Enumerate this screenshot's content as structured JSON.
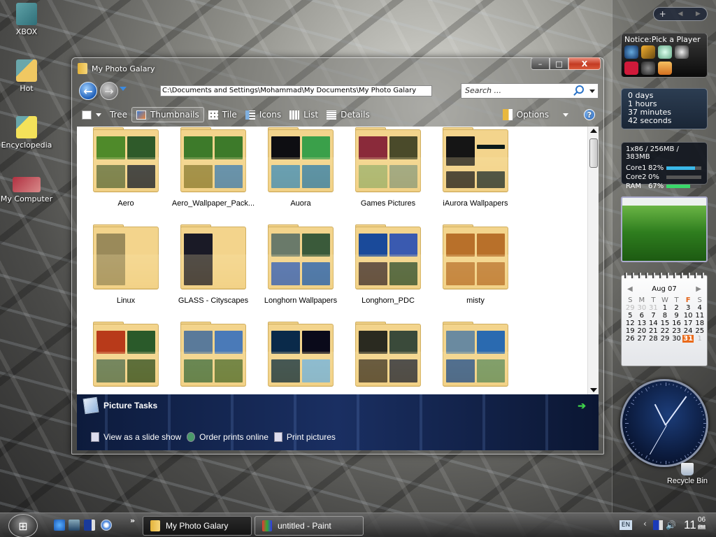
{
  "desktop": {
    "icons": [
      {
        "label": "XBOX"
      },
      {
        "label": "Hot"
      },
      {
        "label": "Encyclopedia"
      },
      {
        "label": "My Computer"
      }
    ],
    "recycle_bin": "Recycle Bin"
  },
  "window": {
    "title": "My Photo Galary",
    "caption": {
      "minimize": "–",
      "maximize": "□",
      "close": "X"
    },
    "address": "C:\\Documents and Settings\\Mohammad\\My Documents\\My Photo Galary",
    "search_placeholder": "Search ...",
    "toolbar": {
      "tree": "Tree",
      "thumbnails": "Thumbnails",
      "tile": "Tile",
      "icons": "Icons",
      "list": "List",
      "details": "Details",
      "options": "Options",
      "help": "?"
    },
    "active_view": "Thumbnails",
    "folders": [
      {
        "name": "Aero",
        "thumbs": [
          "#4f8a2a",
          "#2f5a2a",
          "#5a6a3a",
          "#101828"
        ]
      },
      {
        "name": "Aero_Wallpaper_Pack...",
        "thumbs": [
          "#3d7a2a",
          "#3d7a2a",
          "#8a7a30",
          "#3a7ab0"
        ]
      },
      {
        "name": "Auora",
        "thumbs": [
          "#0e0e12",
          "#3aa04a",
          "#3a8ab8",
          "#2a7aa8"
        ]
      },
      {
        "name": "Games Pictures",
        "thumbs": [
          "#8a2a3a",
          "#4a4a2a",
          "#9ab06a",
          "#8a9a7a"
        ]
      },
      {
        "name": "iAurora Wallpapers",
        "thumbs": [
          "#151515",
          "",
          "#1a1a1a",
          "#1a2a2a"
        ]
      },
      {
        "name": "Linux",
        "thumbs": [
          "#9a8a5a"
        ]
      },
      {
        "name": "GLASS - Cityscapes",
        "thumbs": [
          "#1a1a26"
        ]
      },
      {
        "name": "Longhorn Wallpapers",
        "thumbs": [
          "#6a7a6a",
          "#3a5a3a",
          "#2a5ab8",
          "#1a5ab0"
        ]
      },
      {
        "name": "Longhorn_PDC",
        "thumbs": [
          "#1a4a9a",
          "#3a5ab0",
          "#3a2a2a",
          "#2a4a2a"
        ]
      },
      {
        "name": "misty",
        "thumbs": [
          "#b8702a",
          "#b8702a",
          "#b8702a",
          "#b8702a"
        ]
      },
      {
        "name": "",
        "thumbs": [
          "#b83a1a",
          "#2a5a2a",
          "#4a6a4a",
          "#2a4a1a"
        ]
      },
      {
        "name": "",
        "thumbs": [
          "#5a7a9a",
          "#4a7ab8",
          "#3a6a3a",
          "#4a6a2a"
        ]
      },
      {
        "name": "",
        "thumbs": [
          "#0a2a4a",
          "#0a0a1a",
          "#0a2a3a",
          "#6ab0e0"
        ]
      },
      {
        "name": "",
        "thumbs": [
          "#2a2a20",
          "#3a4a3a",
          "#3a3020",
          "#1a2030"
        ]
      },
      {
        "name": "",
        "thumbs": [
          "#6a8aa0",
          "#2a6ab0",
          "#1a4a8a",
          "#5a8a5a"
        ]
      }
    ],
    "picture_tasks": {
      "title": "Picture Tasks",
      "links": [
        {
          "label": "View as a slide show"
        },
        {
          "label": "Order prints online"
        },
        {
          "label": "Print pictures"
        }
      ],
      "go": "➔"
    }
  },
  "sidebar": {
    "controls": {
      "add": "+",
      "prev": "◀",
      "next": "▶"
    },
    "player": {
      "title": "Notice:Pick a Player",
      "icons": [
        "windows-media-player",
        "winamp",
        "itunes",
        "alien-player",
        "lastfm",
        "player-6",
        "player-7"
      ]
    },
    "uptime": {
      "days": "0 days",
      "hours": "1 hours",
      "minutes": "37 minutes",
      "seconds": "42 seconds"
    },
    "cpu": {
      "summary": "1x86 / 256MB / 383MB",
      "rows": [
        {
          "name": "Core1",
          "percent": "82%",
          "value": 82,
          "color": "#3ab8e8"
        },
        {
          "name": "Core2",
          "percent": "0%",
          "value": 0,
          "color": "#3ab8e8"
        },
        {
          "name": "RAM",
          "percent": "67%",
          "value": 67,
          "color": "#3ad86a"
        }
      ]
    },
    "calendar": {
      "month": "Aug 07",
      "prev": "◀",
      "next": "▶",
      "weekdays": [
        "S",
        "M",
        "T",
        "W",
        "T",
        "F",
        "S"
      ],
      "days": [
        "29",
        "30",
        "31",
        "1",
        "2",
        "3",
        "4",
        "5",
        "6",
        "7",
        "8",
        "9",
        "10",
        "11",
        "12",
        "13",
        "14",
        "15",
        "16",
        "17",
        "18",
        "19",
        "20",
        "21",
        "22",
        "23",
        "24",
        "25",
        "26",
        "27",
        "28",
        "29",
        "30",
        "31",
        "1"
      ],
      "today": "31"
    },
    "clock": {
      "hour": 11,
      "minute": 6
    }
  },
  "taskbar": {
    "start": "⊞",
    "quick_launch": [
      "internet-explorer",
      "show-desktop",
      "switch-windows",
      "media-player"
    ],
    "more": "»",
    "tasks": [
      {
        "label": "My Photo Galary",
        "active": true
      },
      {
        "label": "untitled - Paint",
        "active": false
      }
    ],
    "language": "EN",
    "tray_arrow": "‹",
    "time": {
      "hour": "11",
      "minute": "06",
      "ampm": "PM"
    }
  }
}
